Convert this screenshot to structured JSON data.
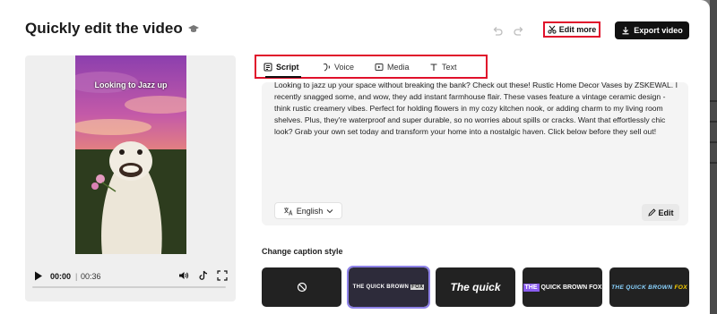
{
  "header": {
    "title": "Quickly edit the video",
    "edit_more_label": "Edit more",
    "export_label": "Export video"
  },
  "player": {
    "overlay_text": "Looking to Jazz up",
    "current_time": "00:00",
    "separator": "|",
    "total_time": "00:36",
    "progress": 0
  },
  "tabs": [
    {
      "label": "Script",
      "icon": "script-icon",
      "active": true
    },
    {
      "label": "Voice",
      "icon": "voice-icon",
      "active": false
    },
    {
      "label": "Media",
      "icon": "media-icon",
      "active": false
    },
    {
      "label": "Text",
      "icon": "text-icon",
      "active": false
    }
  ],
  "script": {
    "text": "Looking to jazz up your space without breaking the bank? Check out these! Rustic Home Decor Vases by ZSKEWAL. I recently snagged some, and wow, they add instant farmhouse flair. These vases feature a vintage ceramic design - think rustic creamery vibes. Perfect for holding flowers in my cozy kitchen nook, or adding charm to my living room shelves. Plus, they're waterproof and super durable, so no worries about spills or cracks. Want that effortlessly chic look? Grab your own set today and transform your home into a nostalgic haven. Click below before they sell out!",
    "language": "English",
    "edit_label": "Edit"
  },
  "captions": {
    "heading": "Change caption style",
    "styles": [
      {
        "name": "none",
        "text": ""
      },
      {
        "name": "style-1",
        "text_main": "THE QUICK BROWN ",
        "text_highlight": "FOX",
        "selected": true
      },
      {
        "name": "style-2",
        "text_main": "The quick"
      },
      {
        "name": "style-3",
        "text_highlight": "THE",
        "text_main": " QUICK BROWN FOX"
      },
      {
        "name": "style-4",
        "text_main": "THE QUICK BROWN ",
        "text_highlight": "FOX"
      }
    ]
  },
  "colors": {
    "accent_red": "#e0112b",
    "selected_purple": "#8e82e8",
    "dark": "#111111"
  }
}
